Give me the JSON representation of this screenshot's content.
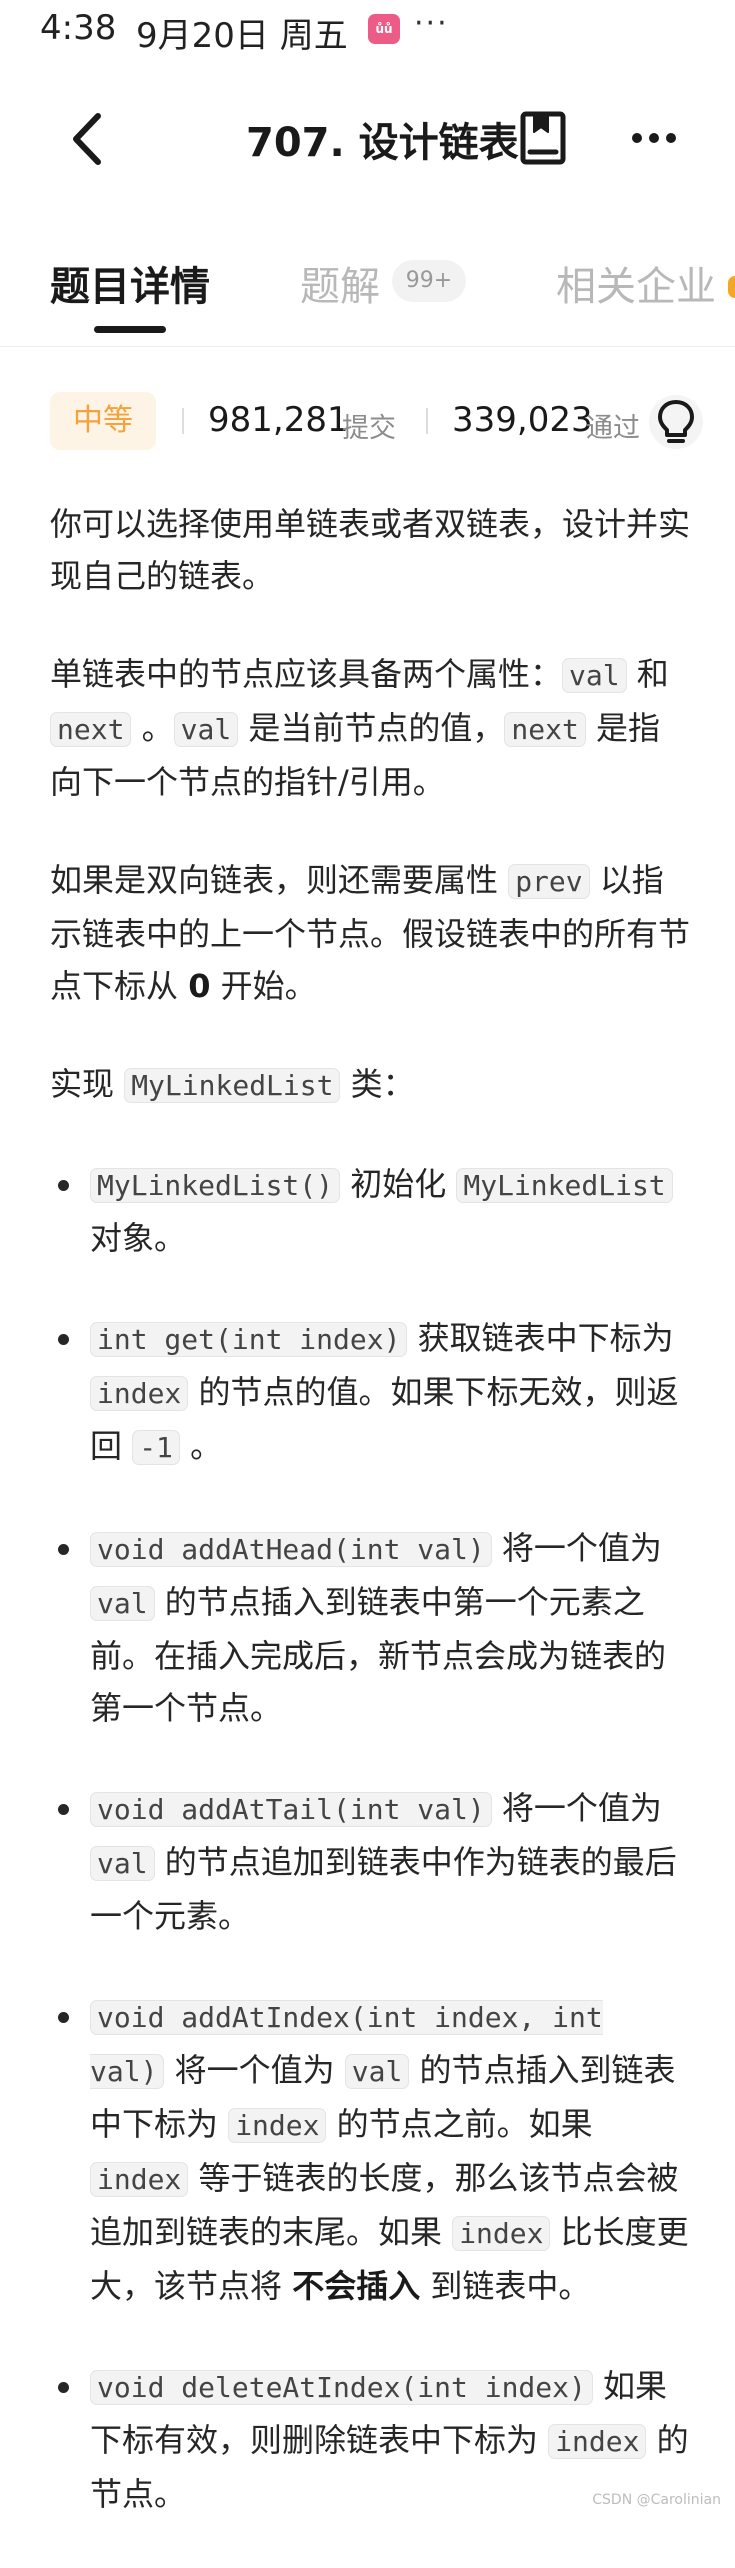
{
  "status_bar": {
    "time": "4:38",
    "date": "9月20日 周五",
    "app_badge": "ůů",
    "more": "···"
  },
  "header": {
    "title": "707. 设计链表",
    "back_icon": "chevron-left-icon",
    "notes_icon": "notebook-icon",
    "more_icon": "more-horizontal-icon"
  },
  "tabs": [
    {
      "label": "题目详情",
      "active": true
    },
    {
      "label": "题解",
      "badge": "99+"
    },
    {
      "label": "相关企业"
    }
  ],
  "stats": {
    "difficulty": "中等",
    "submissions": "981,281",
    "submissions_label": "提交",
    "accepted": "339,023",
    "accepted_label": "通过",
    "hint_icon": "lightbulb-icon"
  },
  "colors": {
    "difficulty_text": "#f5a13c",
    "difficulty_bg": "#fdf4e5",
    "tab_inactive": "#b8b8b8"
  },
  "description": {
    "p1": "你可以选择使用单链表或者双链表，设计并实现自己的链表。",
    "p2_a": "单链表中的节点应该具备两个属性：",
    "p2_code_val": "val",
    "p2_b": "和",
    "p2_code_next": "next",
    "p2_c": "。",
    "p2_code_val2": "val",
    "p2_d": "是当前节点的值，",
    "p2_code_next2": "next",
    "p2_e": "是指向下一个节点的指针/引用。",
    "p3_a": "如果是双向链表，则还需要属性",
    "p3_code": "prev",
    "p3_b": "以指示链表中的上一个节点。假设链表中的所有节点下标从",
    "p3_zero": "0",
    "p3_c": "开始。",
    "p4_a": "实现",
    "p4_code": "MyLinkedList",
    "p4_b": "类："
  },
  "methods": [
    {
      "code": "MyLinkedList()",
      "t1": "初始化",
      "code2": "MyLinkedList",
      "t2": "对象。"
    },
    {
      "code": "int get(int index)",
      "t1": "获取链表中下标为",
      "code2": "index",
      "t2": "的节点的值。如果下标无效，则返回",
      "code3": "-1",
      "t3": "。"
    },
    {
      "code": "void addAtHead(int val)",
      "t1": "将一个值为",
      "code2": "val",
      "t2": "的节点插入到链表中第一个元素之前。在插入完成后，新节点会成为链表的第一个节点。"
    },
    {
      "code": "void addAtTail(int val)",
      "t1": "将一个值为",
      "code2": "val",
      "t2": "的节点追加到链表中作为链表的最后一个元素。"
    },
    {
      "code": "void addAtIndex(int index, int val)",
      "t1": "将一个值为",
      "code2": "val",
      "t2": "的节点插入到链表中下标为",
      "code3": "index",
      "t3": "的节点之前。如果",
      "code4": "index",
      "t4": "等于链表的长度，那么该节点会被追加到链表的末尾。如果",
      "code5": "index",
      "t5": "比长度更大，该节点将",
      "bold": "不会插入",
      "t6": "到链表中。"
    },
    {
      "code": "void deleteAtIndex(int index)",
      "t1": "如果下标有效，则删除链表中下标为",
      "code2": "index",
      "t2": "的节点。"
    }
  ],
  "footer": {
    "watermark": "CSDN @Carolinian"
  }
}
